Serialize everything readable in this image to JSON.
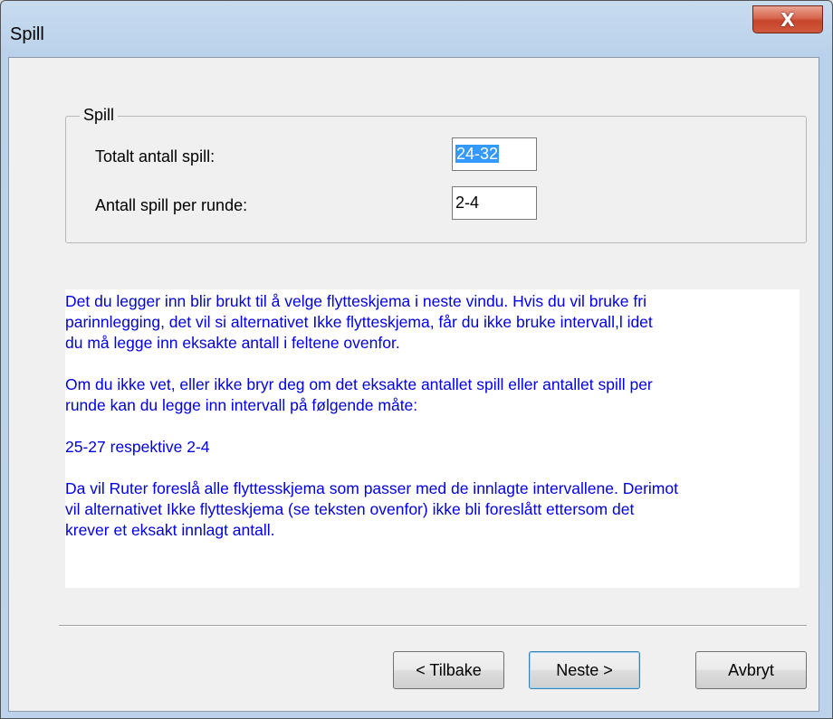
{
  "window": {
    "title": "Spill",
    "close_label": "X"
  },
  "group": {
    "legend": "Spill",
    "fields": [
      {
        "label": "Totalt antall spill:",
        "value": "24-32",
        "selected": true
      },
      {
        "label": "Antall spill per runde:",
        "value": "2-4",
        "selected": false
      }
    ]
  },
  "info": {
    "paragraphs": [
      "Det du legger inn blir brukt til å velge flytteskjema i neste vindu. Hvis du vil bruke fri\nparinnlegging, det vil si alternativet Ikke flytteskjema, får du ikke bruke intervall,l idet\ndu må legge inn eksakte antall i feltene ovenfor.",
      "Om du ikke vet, eller ikke bryr deg om det eksakte antallet spill eller antallet spill per\nrunde kan du legge inn intervall på følgende måte:",
      "25-27 respektive 2-4",
      "Da vil Ruter foreslå alle flyttesskjema som passer med de innlagte intervallene. Derimot\nvil alternativet Ikke flytteskjema (se teksten ovenfor) ikke bli foreslått ettersom det\nkrever et eksakt innlagt antall."
    ]
  },
  "buttons": {
    "back": "< Tilbake",
    "next": "Neste >",
    "cancel": "Avbryt"
  }
}
